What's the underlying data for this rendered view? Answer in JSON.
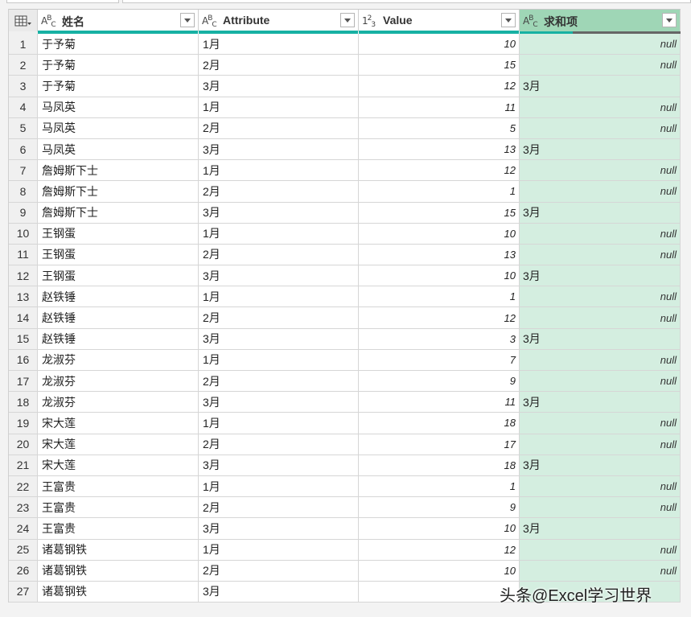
{
  "columns": [
    {
      "type_icon": "ABC",
      "label": "姓名"
    },
    {
      "type_icon": "ABC",
      "label": "Attribute"
    },
    {
      "type_icon": "123",
      "label": "Value"
    },
    {
      "type_icon": "ABC",
      "label": "求和项"
    }
  ],
  "colors": {
    "quality_bar": "#17b1a3",
    "selected_column": "#d4eee0",
    "selected_header": "#9fd6b6"
  },
  "rows": [
    {
      "n": "1",
      "name": "于予菊",
      "attr": "1月",
      "value": "10",
      "sum": "null"
    },
    {
      "n": "2",
      "name": "于予菊",
      "attr": "2月",
      "value": "15",
      "sum": "null"
    },
    {
      "n": "3",
      "name": "于予菊",
      "attr": "3月",
      "value": "12",
      "sum": "3月"
    },
    {
      "n": "4",
      "name": "马凤英",
      "attr": "1月",
      "value": "11",
      "sum": "null"
    },
    {
      "n": "5",
      "name": "马凤英",
      "attr": "2月",
      "value": "5",
      "sum": "null"
    },
    {
      "n": "6",
      "name": "马凤英",
      "attr": "3月",
      "value": "13",
      "sum": "3月"
    },
    {
      "n": "7",
      "name": "詹姆斯下士",
      "attr": "1月",
      "value": "12",
      "sum": "null"
    },
    {
      "n": "8",
      "name": "詹姆斯下士",
      "attr": "2月",
      "value": "1",
      "sum": "null"
    },
    {
      "n": "9",
      "name": "詹姆斯下士",
      "attr": "3月",
      "value": "15",
      "sum": "3月"
    },
    {
      "n": "10",
      "name": "王钢蛋",
      "attr": "1月",
      "value": "10",
      "sum": "null"
    },
    {
      "n": "11",
      "name": "王钢蛋",
      "attr": "2月",
      "value": "13",
      "sum": "null"
    },
    {
      "n": "12",
      "name": "王钢蛋",
      "attr": "3月",
      "value": "10",
      "sum": "3月"
    },
    {
      "n": "13",
      "name": "赵铁锤",
      "attr": "1月",
      "value": "1",
      "sum": "null"
    },
    {
      "n": "14",
      "name": "赵铁锤",
      "attr": "2月",
      "value": "12",
      "sum": "null"
    },
    {
      "n": "15",
      "name": "赵铁锤",
      "attr": "3月",
      "value": "3",
      "sum": "3月"
    },
    {
      "n": "16",
      "name": "龙淑芬",
      "attr": "1月",
      "value": "7",
      "sum": "null"
    },
    {
      "n": "17",
      "name": "龙淑芬",
      "attr": "2月",
      "value": "9",
      "sum": "null"
    },
    {
      "n": "18",
      "name": "龙淑芬",
      "attr": "3月",
      "value": "11",
      "sum": "3月"
    },
    {
      "n": "19",
      "name": "宋大莲",
      "attr": "1月",
      "value": "18",
      "sum": "null"
    },
    {
      "n": "20",
      "name": "宋大莲",
      "attr": "2月",
      "value": "17",
      "sum": "null"
    },
    {
      "n": "21",
      "name": "宋大莲",
      "attr": "3月",
      "value": "18",
      "sum": "3月"
    },
    {
      "n": "22",
      "name": "王富贵",
      "attr": "1月",
      "value": "1",
      "sum": "null"
    },
    {
      "n": "23",
      "name": "王富贵",
      "attr": "2月",
      "value": "9",
      "sum": "null"
    },
    {
      "n": "24",
      "name": "王富贵",
      "attr": "3月",
      "value": "10",
      "sum": "3月"
    },
    {
      "n": "25",
      "name": "诸葛钢铁",
      "attr": "1月",
      "value": "12",
      "sum": "null"
    },
    {
      "n": "26",
      "name": "诸葛钢铁",
      "attr": "2月",
      "value": "10",
      "sum": "null"
    },
    {
      "n": "27",
      "name": "诸葛钢铁",
      "attr": "3月",
      "value": "",
      "sum": ""
    }
  ],
  "watermark": "头条@Excel学习世界"
}
